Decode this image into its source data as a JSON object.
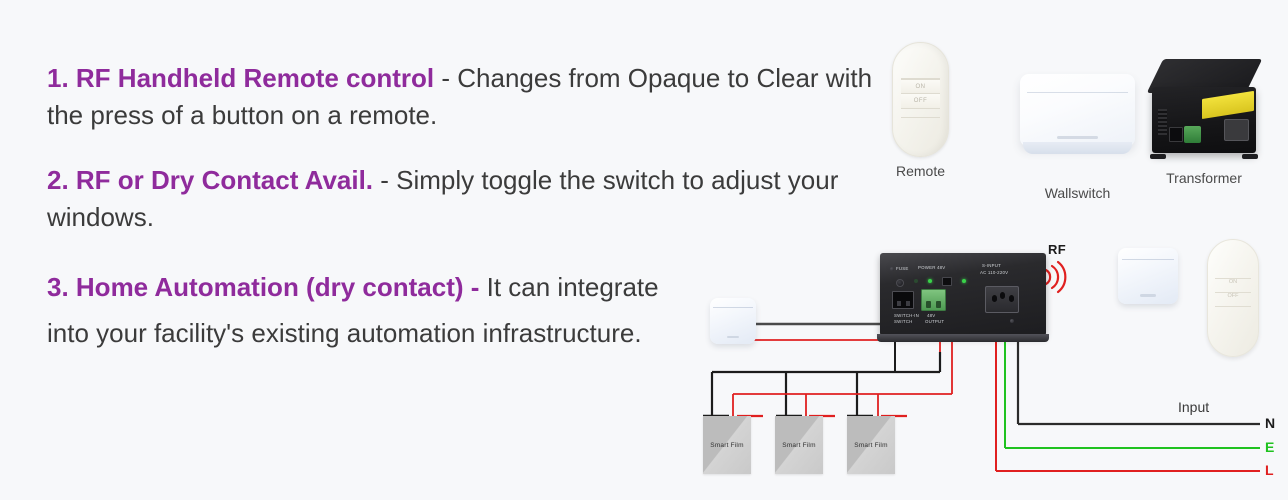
{
  "theme": {
    "background": "#f7f8fa",
    "accent_purple": "#8f2b9c",
    "body_text": "#3b3b3b",
    "wire_black": "#1c1c1c",
    "wire_red": "#e02020",
    "wire_green": "#1fc21f",
    "wire_gray": "#4a4a4a"
  },
  "features": [
    {
      "id": "feature-1",
      "lead": "1. RF Handheld Remote control",
      "body": " - Changes from Opaque to Clear with the press of a button on a remote."
    },
    {
      "id": "feature-2",
      "lead": "2. RF or Dry Contact Avail.",
      "body": " - Simply toggle the switch to adjust your windows."
    },
    {
      "id": "feature-3",
      "lead": "3. Home Automation (dry contact) -",
      "body": " It can integrate into your facility's existing automation infrastructure."
    }
  ],
  "products": [
    {
      "id": "remote",
      "caption": "Remote",
      "on_label": "ON",
      "off_label": "OFF"
    },
    {
      "id": "wallswitch",
      "caption": "Wallswitch"
    },
    {
      "id": "transformer",
      "caption": "Transformer"
    }
  ],
  "diagram": {
    "rf_label": "RF",
    "input_label": "Input",
    "terminals": [
      {
        "id": "terminal-n",
        "label": "N",
        "color": "#1c1c1c"
      },
      {
        "id": "terminal-e",
        "label": "E",
        "color": "#1fc21f"
      },
      {
        "id": "terminal-l",
        "label": "L",
        "color": "#e02020"
      }
    ],
    "films": [
      {
        "id": "smart-film-1",
        "label": "Smart Film"
      },
      {
        "id": "smart-film-2",
        "label": "Smart Film"
      },
      {
        "id": "smart-film-3",
        "label": "Smart Film"
      }
    ],
    "controller": {
      "panel_labels": [
        "FUSE",
        "POWER 48V",
        "S-INPUT",
        "AC 110-220V",
        "SWITCH-IN",
        "SWITCH",
        "48V",
        "OUTPUT"
      ]
    },
    "remote": {
      "on_label": "ON",
      "off_label": "OFF"
    }
  }
}
